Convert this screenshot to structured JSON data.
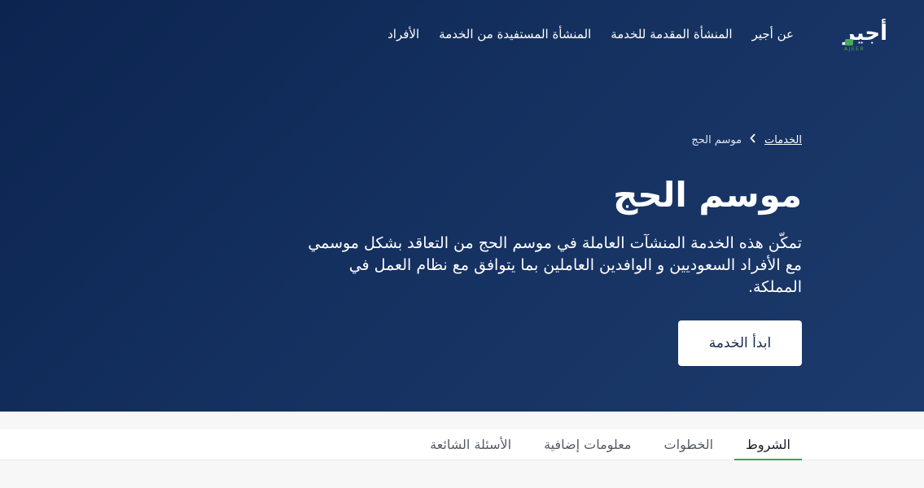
{
  "brand": {
    "logo_text_ar": "أجير",
    "logo_text_en": "AJEER",
    "accent_color": "#49a85c"
  },
  "nav": {
    "items": [
      {
        "label": "عن أجير"
      },
      {
        "label": "المنشأة المقدمة للخدمة"
      },
      {
        "label": "المنشأة المستفيدة من الخدمة"
      },
      {
        "label": "الأفراد"
      }
    ]
  },
  "breadcrumb": {
    "parent": "الخدمات",
    "separator_icon": "chevron-left-icon",
    "current": "موسم الحج"
  },
  "hero": {
    "title": "موسم الحج",
    "description": "تمكّن هذه الخدمة المنشآت العاملة في موسم الحج من التعاقد بشكل موسمي مع الأفراد السعوديين و الوافدين العاملين بما يتوافق مع نظام العمل في المملكة.",
    "start_button": "ابدأ الخدمة",
    "background_color": "#14305f"
  },
  "tabs": {
    "items": [
      {
        "label": "الشروط",
        "active": true
      },
      {
        "label": "الخطوات",
        "active": false
      },
      {
        "label": "معلومات إضافية",
        "active": false
      },
      {
        "label": "الأسئلة الشائعة",
        "active": false
      }
    ],
    "active_underline_color": "#3aa35a"
  }
}
